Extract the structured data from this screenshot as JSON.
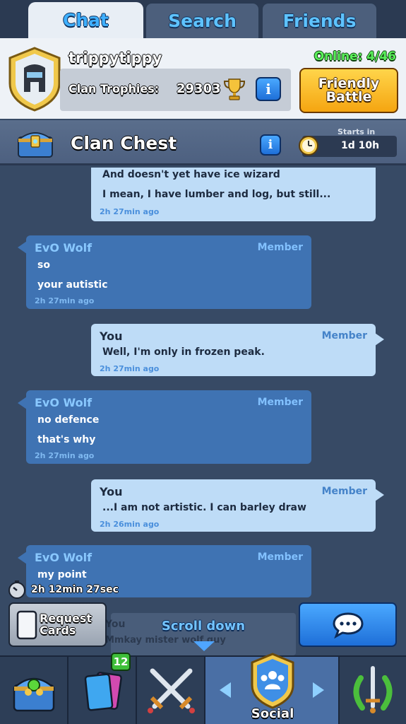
{
  "tabs": [
    {
      "label": "Chat",
      "active": true
    },
    {
      "label": "Search",
      "active": false
    },
    {
      "label": "Friends",
      "active": false
    }
  ],
  "clan": {
    "name": "trippytippy",
    "online": "Online: 4/46",
    "trophies_label": "Clan Trophies:",
    "trophies_value": "29303",
    "info_glyph": "i",
    "friendly_battle_label": "Friendly\nBattle"
  },
  "clan_chest": {
    "title": "Clan Chest",
    "info_glyph": "i",
    "starts_in_label": "Starts in",
    "starts_in_value": "1d 10h"
  },
  "messages": [
    {
      "kind": "self",
      "author": "",
      "role": "",
      "lines": [
        "And doesn't yet have ice wizard",
        "I mean, I have lumber and log, but still..."
      ],
      "time": "2h 27min ago"
    },
    {
      "kind": "other",
      "author": "EvO Wolf",
      "role": "Member",
      "lines": [
        "so",
        "your autistic"
      ],
      "time": "2h 27min ago"
    },
    {
      "kind": "self",
      "author": "You",
      "role": "Member",
      "lines": [
        "Well, I'm only in frozen peak."
      ],
      "time": "2h 27min ago"
    },
    {
      "kind": "other",
      "author": "EvO Wolf",
      "role": "Member",
      "lines": [
        "no defence",
        "that's why"
      ],
      "time": "2h 27min ago"
    },
    {
      "kind": "self",
      "author": "You",
      "role": "Member",
      "lines": [
        "...I am not artistic. I can barley draw"
      ],
      "time": "2h 26min ago"
    },
    {
      "kind": "other",
      "author": "EvO Wolf",
      "role": "Member",
      "lines": [
        "my point"
      ],
      "time": ""
    }
  ],
  "request_countdown": "2h 12min  27sec",
  "actions": {
    "request_cards_label": "Request\nCards",
    "scroll_down_label": "Scroll down",
    "ghost_author": "You",
    "ghost_text": "Mmkay mister wolf guy"
  },
  "bottom_nav": {
    "cards_badge": "12",
    "social_label": "Social"
  },
  "colors": {
    "background": "#374a65",
    "self_bubble": "#bedcf7",
    "other_bubble": "#3f73b3",
    "online_green": "#5bf05b",
    "accent_blue": "#3fb0ff",
    "button_orange": "#f5a511"
  },
  "icons": [
    "clan-badge-icon",
    "trophy-icon",
    "info-icon",
    "chest-icon",
    "clock-icon",
    "stopwatch-icon",
    "card-icon",
    "speech-bubble-icon",
    "chest-nav-icon",
    "cards-nav-icon",
    "battle-swords-icon",
    "social-people-icon",
    "tournament-icon"
  ]
}
